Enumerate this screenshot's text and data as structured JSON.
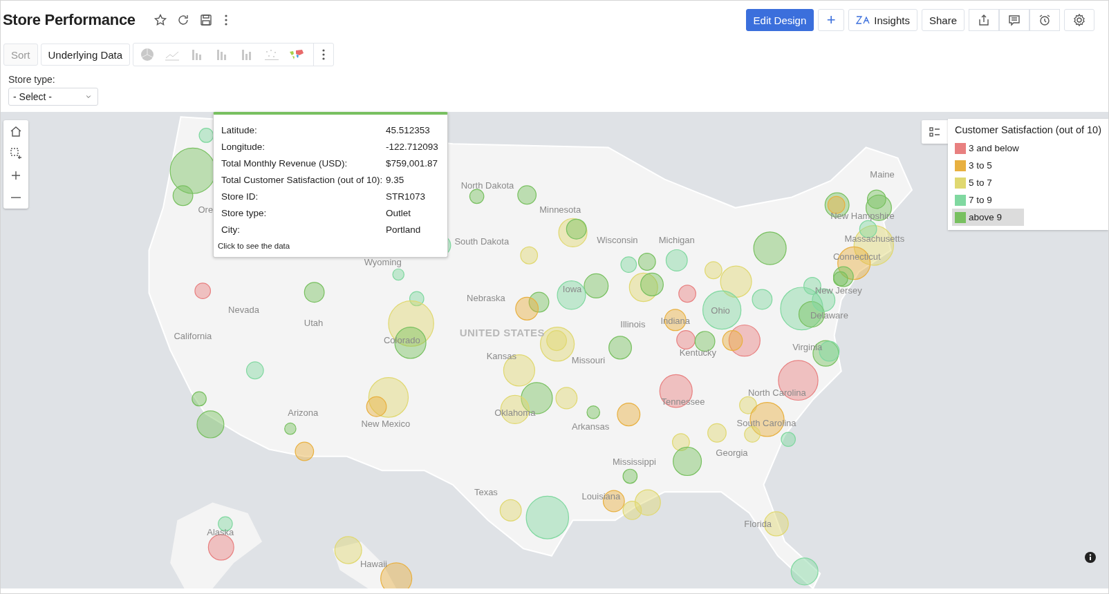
{
  "header": {
    "title": "Store Performance",
    "actions": [
      {
        "label": "Edit Design",
        "kind": "primary"
      },
      {
        "label": "+",
        "kind": "plus"
      },
      {
        "label": "Insights",
        "kind": "insights"
      },
      {
        "label": "Share",
        "kind": "plain"
      }
    ]
  },
  "toolbar": {
    "sort": {
      "label": "Sort",
      "disabled": true
    },
    "underlying": {
      "label": "Underlying Data",
      "disabled": false
    }
  },
  "filter": {
    "label": "Store type:",
    "value": "- Select -"
  },
  "map": {
    "labels": [
      {
        "text": "Maine",
        "kind": "state"
      },
      {
        "text": "North Dakota",
        "kind": "state"
      },
      {
        "text": "Ore",
        "kind": "state"
      },
      {
        "text": "Minnesota",
        "kind": "state"
      },
      {
        "text": "New Hampshire",
        "kind": "state"
      },
      {
        "text": "South Dakota",
        "kind": "state"
      },
      {
        "text": "Wisconsin",
        "kind": "state"
      },
      {
        "text": "Michigan",
        "kind": "state"
      },
      {
        "text": "Massachusetts",
        "kind": "state"
      },
      {
        "text": "Wyoming",
        "kind": "state"
      },
      {
        "text": "Connecticut",
        "kind": "state"
      },
      {
        "text": "Nebraska",
        "kind": "state"
      },
      {
        "text": "Iowa",
        "kind": "state"
      },
      {
        "text": "New Jersey",
        "kind": "state"
      },
      {
        "text": "Nevada",
        "kind": "state"
      },
      {
        "text": "Utah",
        "kind": "state"
      },
      {
        "text": "Illinois",
        "kind": "state"
      },
      {
        "text": "Indiana",
        "kind": "state"
      },
      {
        "text": "Ohio",
        "kind": "state"
      },
      {
        "text": "Delaware",
        "kind": "state"
      },
      {
        "text": "California",
        "kind": "state"
      },
      {
        "text": "Colorado",
        "kind": "state"
      },
      {
        "text": "UNITED STATES",
        "kind": "country"
      },
      {
        "text": "Kansas",
        "kind": "state"
      },
      {
        "text": "Missouri",
        "kind": "state"
      },
      {
        "text": "Kentucky",
        "kind": "state"
      },
      {
        "text": "Virginia",
        "kind": "state"
      },
      {
        "text": "Tennessee",
        "kind": "state"
      },
      {
        "text": "North Carolina",
        "kind": "state"
      },
      {
        "text": "Arizona",
        "kind": "state"
      },
      {
        "text": "New Mexico",
        "kind": "state"
      },
      {
        "text": "Oklahoma",
        "kind": "state"
      },
      {
        "text": "Arkansas",
        "kind": "state"
      },
      {
        "text": "South Carolina",
        "kind": "state"
      },
      {
        "text": "Mississippi",
        "kind": "state"
      },
      {
        "text": "Georgia",
        "kind": "state"
      },
      {
        "text": "Texas",
        "kind": "state"
      },
      {
        "text": "Louisiana",
        "kind": "state"
      },
      {
        "text": "Alaska",
        "kind": "state"
      },
      {
        "text": "Florida",
        "kind": "state"
      },
      {
        "text": "Hawaii",
        "kind": "state"
      }
    ],
    "tooltip": {
      "color": "#78c060",
      "rows": [
        {
          "label": "Latitude:",
          "value": "45.512353"
        },
        {
          "label": "Longitude:",
          "value": "-122.712093"
        },
        {
          "label": "Total Monthly Revenue (USD):",
          "value": "$759,001.87"
        },
        {
          "label": "Total Customer Satisfaction (out of 10):",
          "value": "9.35"
        },
        {
          "label": "Store ID:",
          "value": "STR1073"
        },
        {
          "label": "Store type:",
          "value": "Outlet"
        },
        {
          "label": "City:",
          "value": "Portland"
        }
      ],
      "footer": "Click to see the data"
    },
    "legend": {
      "title": "Customer Satisfaction (out of 10)",
      "items": [
        {
          "label": "3 and below",
          "color": "#e88080",
          "selected": false
        },
        {
          "label": "3 to 5",
          "color": "#e8b040",
          "selected": false
        },
        {
          "label": "5 to 7",
          "color": "#e0d870",
          "selected": false
        },
        {
          "label": "7 to 9",
          "color": "#80d8a0",
          "selected": false
        },
        {
          "label": "above 9",
          "color": "#78c060",
          "selected": true
        }
      ]
    }
  }
}
